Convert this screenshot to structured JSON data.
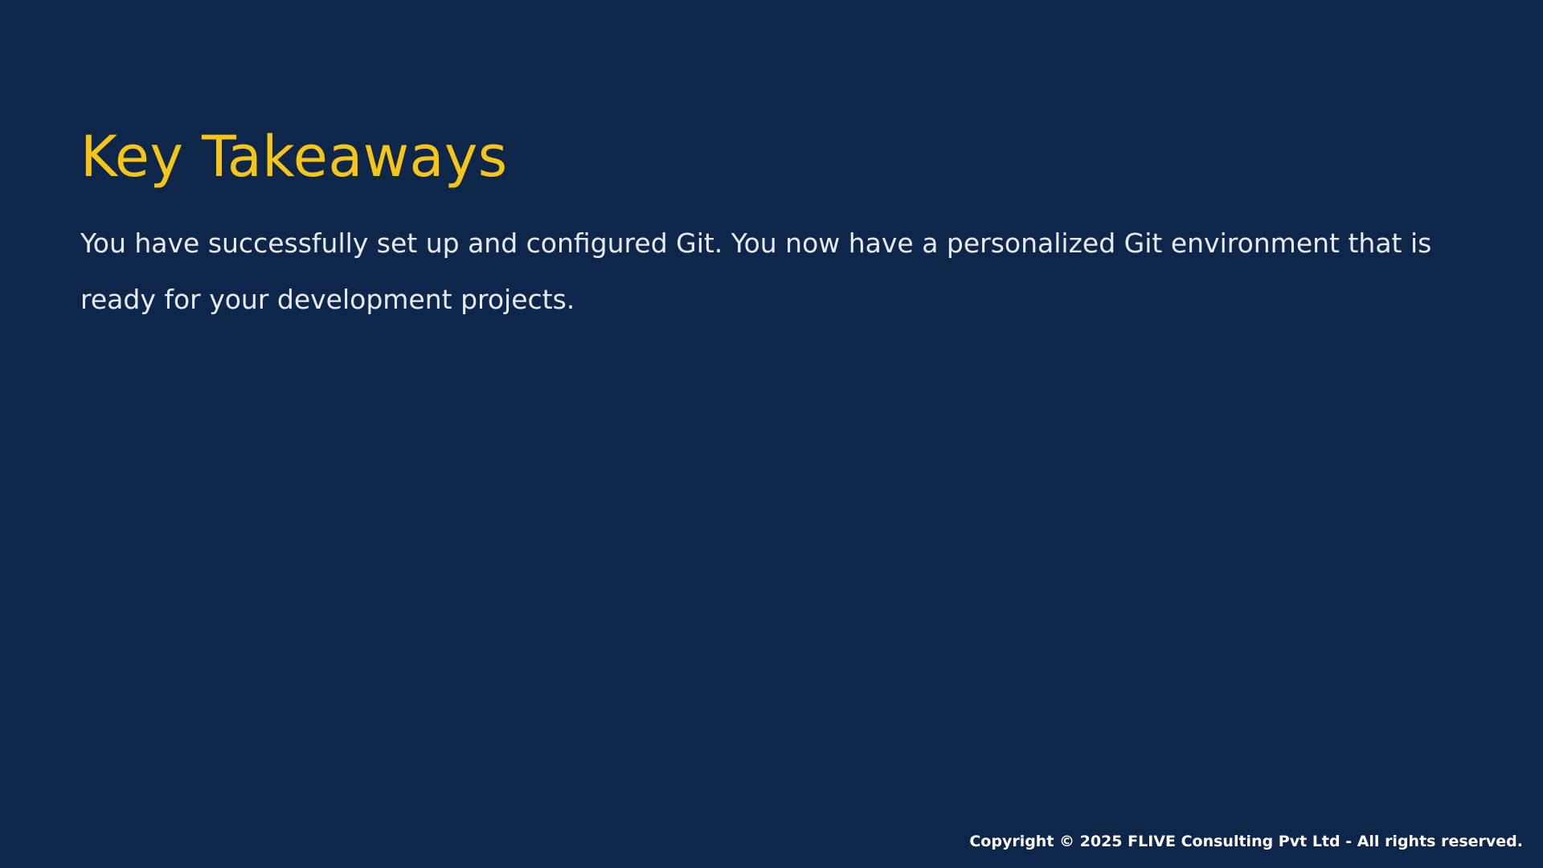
{
  "slide": {
    "title": "Key Takeaways",
    "body": "You have successfully set up and configured Git. You now have a personalized Git environment that is ready for your development projects.",
    "footer": "Copyright © 2025 FLIVE Consulting Pvt Ltd - All rights reserved."
  },
  "colors": {
    "background": "#0e2649",
    "title": "#f5c518",
    "body_text": "#e6ebf2",
    "footer_text": "#ffffff"
  }
}
